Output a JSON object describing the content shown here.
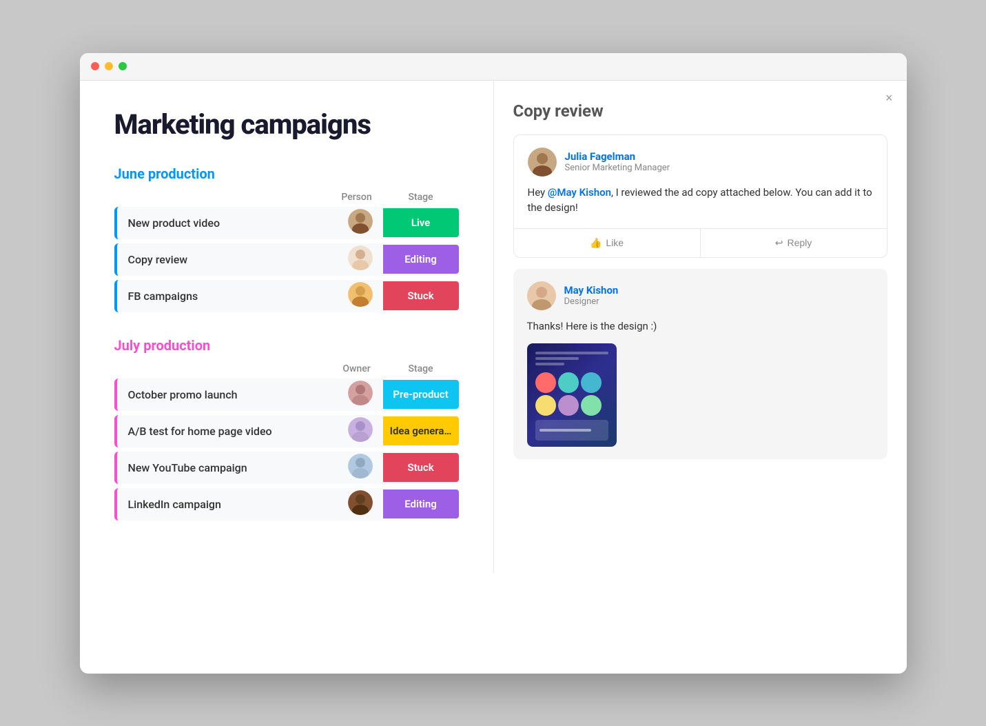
{
  "window": {
    "titlebar": {
      "dot_red": "close",
      "dot_yellow": "minimize",
      "dot_green": "maximize"
    }
  },
  "left": {
    "page_title": "Marketing campaigns",
    "section1": {
      "title": "June production",
      "col_person": "Person",
      "col_stage": "Stage",
      "rows": [
        {
          "name": "New product video",
          "stage": "Live",
          "stage_class": "stage-live"
        },
        {
          "name": "Copy review",
          "stage": "Editing",
          "stage_class": "stage-editing"
        },
        {
          "name": "FB campaigns",
          "stage": "Stuck",
          "stage_class": "stage-stuck"
        }
      ]
    },
    "section2": {
      "title": "July production",
      "col_owner": "Owner",
      "col_stage": "Stage",
      "rows": [
        {
          "name": "October promo launch",
          "stage": "Pre-product",
          "stage_class": "stage-preprod"
        },
        {
          "name": "A/B test for home page video",
          "stage": "Idea genera…",
          "stage_class": "stage-idea"
        },
        {
          "name": "New YouTube campaign",
          "stage": "Stuck",
          "stage_class": "stage-stuck"
        },
        {
          "name": "LinkedIn campaign",
          "stage": "Editing",
          "stage_class": "stage-editing"
        }
      ]
    }
  },
  "right": {
    "close_label": "×",
    "panel_title": "Copy review",
    "comments": [
      {
        "id": "comment-1",
        "author_name": "Julia Fagelman",
        "author_role": "Senior Marketing Manager",
        "text_before_mention": "Hey ",
        "mention": "@May Kishon",
        "text_after_mention": ", I reviewed the ad copy attached below. You can add it to the design!",
        "like_label": "Like",
        "reply_label": "Reply"
      },
      {
        "id": "comment-2",
        "author_name": "May Kishon",
        "author_role": "Designer",
        "text": "Thanks! Here is the design :)"
      }
    ]
  },
  "icons": {
    "like": "👍",
    "reply": "↩"
  }
}
